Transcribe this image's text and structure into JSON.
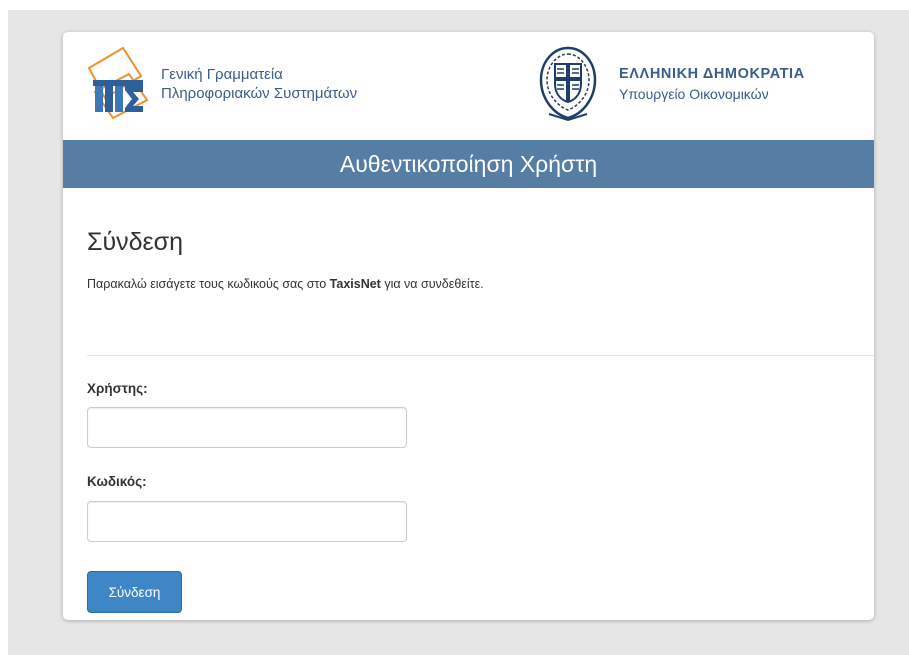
{
  "header": {
    "org_line1": "Γενική Γραμματεία",
    "org_line2": "Πληροφοριακών Συστημάτων",
    "gov_title": "ΕΛΛΗΝΙΚΗ ΔΗΜΟΚΡΑΤΙΑ",
    "gov_subtitle": "Υπουργείο Οικονομικών"
  },
  "banner": {
    "title": "Αυθεντικοποίηση Χρήστη"
  },
  "login": {
    "heading": "Σύνδεση",
    "instructions_before": "Παρακαλώ εισάγετε τους κωδικούς σας στο ",
    "instructions_bold": "TaxisNet",
    "instructions_after": " για να συνδεθείτε.",
    "username_label": "Χρήστης:",
    "username_value": "",
    "password_label": "Κωδικός:",
    "password_value": "",
    "submit_label": "Σύνδεση"
  },
  "colors": {
    "banner": "#567da4",
    "button": "#3f86c6",
    "brand_text": "#3a5d8c"
  },
  "icons": {
    "org_logo": "gsis-logo",
    "emblem": "greek-coat-of-arms-emblem"
  }
}
